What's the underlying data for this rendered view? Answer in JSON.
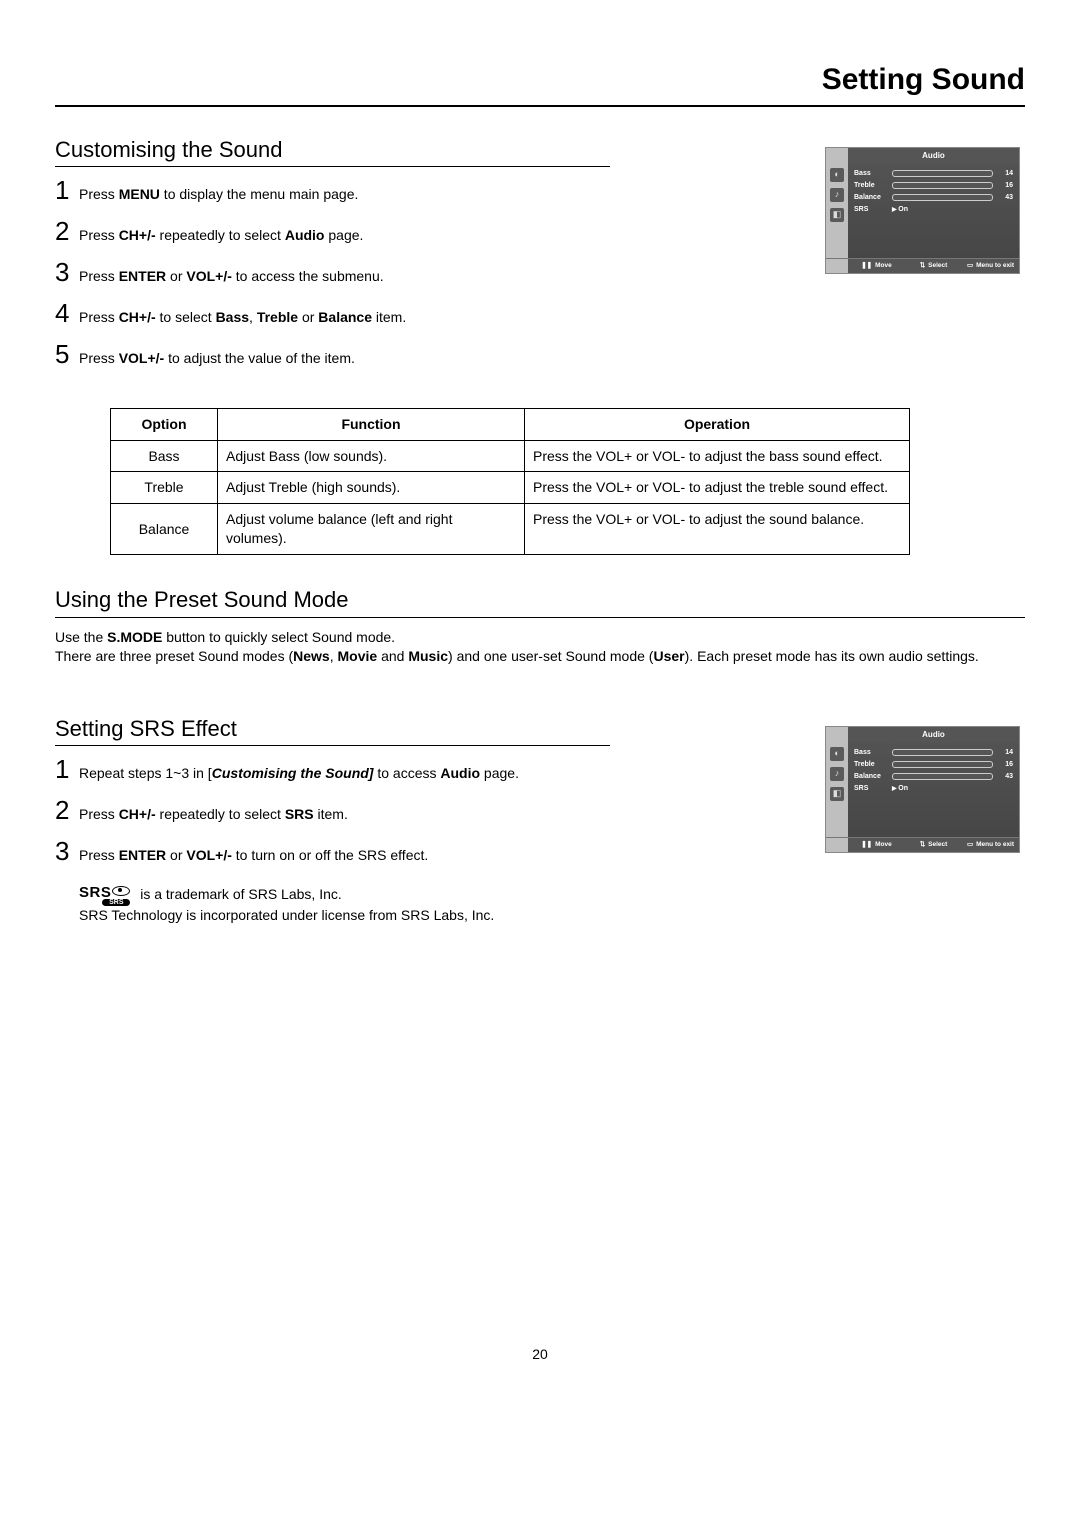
{
  "page_title": "Setting Sound",
  "page_number": "20",
  "sections": {
    "customising": {
      "title": "Customising the Sound",
      "steps": [
        {
          "pre": "Press ",
          "b1": "MENU",
          "post": " to display the menu main page."
        },
        {
          "pre": "Press ",
          "b1": "CH+/-",
          "mid": " repeatedly to select ",
          "b2": "Audio",
          "post": " page."
        },
        {
          "pre": "Press ",
          "b1": "ENTER",
          "mid": " or ",
          "b2": "VOL+/-",
          "post": " to access the submenu."
        },
        {
          "pre": "Press ",
          "b1": "CH+/-",
          "mid": " to select ",
          "b2": "Bass",
          "mid2": ", ",
          "b3": "Treble",
          "mid3": " or ",
          "b4": "Balance",
          "post": " item."
        },
        {
          "pre": "Press ",
          "b1": "VOL+/-",
          "post": " to adjust the value of the item."
        }
      ]
    },
    "table": {
      "headers": {
        "option": "Option",
        "function": "Function",
        "operation": "Operation"
      },
      "rows": [
        {
          "option": "Bass",
          "function": "Adjust Bass (low sounds).",
          "operation": "Press the VOL+ or VOL- to adjust the bass sound effect."
        },
        {
          "option": "Treble",
          "function": "Adjust Treble (high sounds).",
          "operation": "Press the VOL+ or VOL- to adjust the treble sound effect."
        },
        {
          "option": "Balance",
          "function": "Adjust volume balance (left and right volumes).",
          "operation": "Press the VOL+ or VOL- to adjust the sound balance."
        }
      ]
    },
    "preset": {
      "title": "Using the Preset Sound Mode",
      "line1_pre": "Use the ",
      "line1_b": "S.MODE",
      "line1_post": " button to quickly select Sound mode.",
      "line2_pre": "There are three preset Sound modes (",
      "line2_b1": "News",
      "line2_mid1": ", ",
      "line2_b2": "Movie",
      "line2_mid2": " and ",
      "line2_b3": "Music",
      "line2_mid3": ") and one user-set Sound mode (",
      "line2_b4": "User",
      "line2_post": "). Each preset mode has its own audio settings."
    },
    "srs": {
      "title": "Setting SRS Effect",
      "steps": [
        {
          "pre": "Repeat steps 1~3 in [",
          "bi": "Customising the Sound]",
          "mid": " to access ",
          "b2": "Audio",
          "post": " page."
        },
        {
          "pre": "Press ",
          "b1": "CH+/-",
          "mid": " repeatedly to select ",
          "b2": "SRS",
          "post": " item."
        },
        {
          "pre": "Press ",
          "b1": "ENTER",
          "mid": " or ",
          "b2": "VOL+/-",
          "post": " to turn on or off the SRS effect."
        }
      ],
      "trademark1": " is a trademark of SRS Labs, Inc.",
      "trademark2": "SRS Technology is incorporated under license from SRS Labs, Inc.",
      "logo_main": "SRS",
      "logo_sub": "SRS"
    }
  },
  "osd": {
    "title": "Audio",
    "rows": [
      {
        "label": "Bass",
        "value": "14"
      },
      {
        "label": "Treble",
        "value": "16"
      },
      {
        "label": "Balance",
        "value": "43"
      }
    ],
    "srs_label": "SRS",
    "srs_value": "On",
    "footer": {
      "move": "Move",
      "select": "Select",
      "exit": "Menu to exit"
    },
    "icons": {
      "pic": "◐",
      "aud": "♪",
      "misc": "◧"
    }
  }
}
